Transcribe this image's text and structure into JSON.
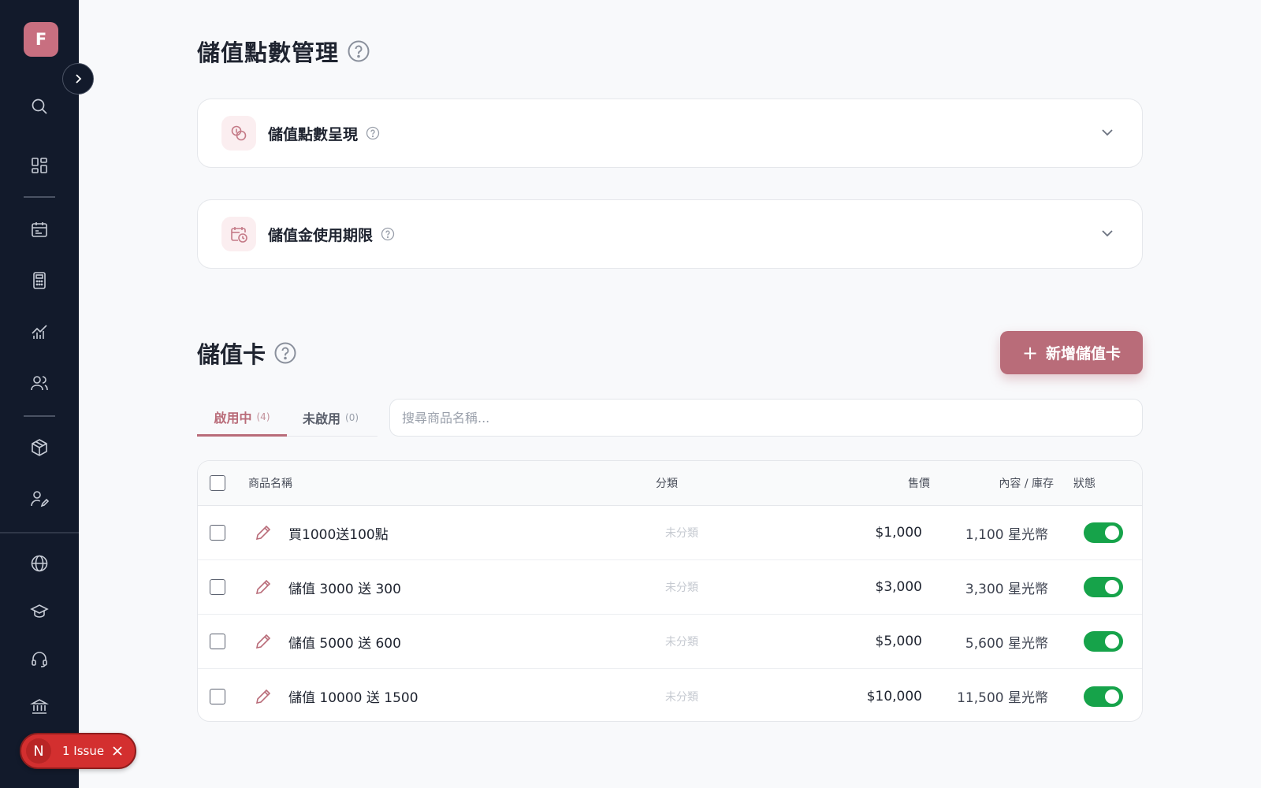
{
  "sidebar": {
    "avatar_letter": "F",
    "icons": [
      "search-icon",
      "dashboard-icon",
      "calendar-icon",
      "calculator-icon",
      "analytics-icon",
      "users-icon",
      "box-icon",
      "user-edit-icon",
      "globe-icon",
      "graduation-cap-icon",
      "headset-icon",
      "bank-icon"
    ]
  },
  "issue_badge": {
    "letter": "N",
    "label": "1 Issue"
  },
  "page": {
    "title": "儲值點數管理"
  },
  "cards": [
    {
      "title": "儲值點數呈現"
    },
    {
      "title": "儲值金使用期限"
    }
  ],
  "section": {
    "title": "儲值卡",
    "add_label": "新增儲值卡"
  },
  "tabs": [
    {
      "label": "啟用中",
      "count": "(4)"
    },
    {
      "label": "未啟用",
      "count": "(0)"
    }
  ],
  "search": {
    "placeholder": "搜尋商品名稱..."
  },
  "table": {
    "headers": {
      "name": "商品名稱",
      "category": "分類",
      "price": "售價",
      "stock": "內容 / 庫存",
      "status": "狀態"
    },
    "rows": [
      {
        "name": "買1000送100點",
        "category": "未分類",
        "price": "$1,000",
        "stock": "1,100 星光幣",
        "enabled": true
      },
      {
        "name": "儲值 3000 送 300",
        "category": "未分類",
        "price": "$3,000",
        "stock": "3,300 星光幣",
        "enabled": true
      },
      {
        "name": "儲值 5000 送 600",
        "category": "未分類",
        "price": "$5,000",
        "stock": "5,600 星光幣",
        "enabled": true
      },
      {
        "name": "儲值 10000 送 1500",
        "category": "未分類",
        "price": "$10,000",
        "stock": "11,500 星光幣",
        "enabled": true
      }
    ]
  },
  "colors": {
    "sidebar_bg": "#121a2b",
    "accent": "#b96c79",
    "toggle_on": "#16a34a",
    "issue_red": "#d32f2f"
  }
}
